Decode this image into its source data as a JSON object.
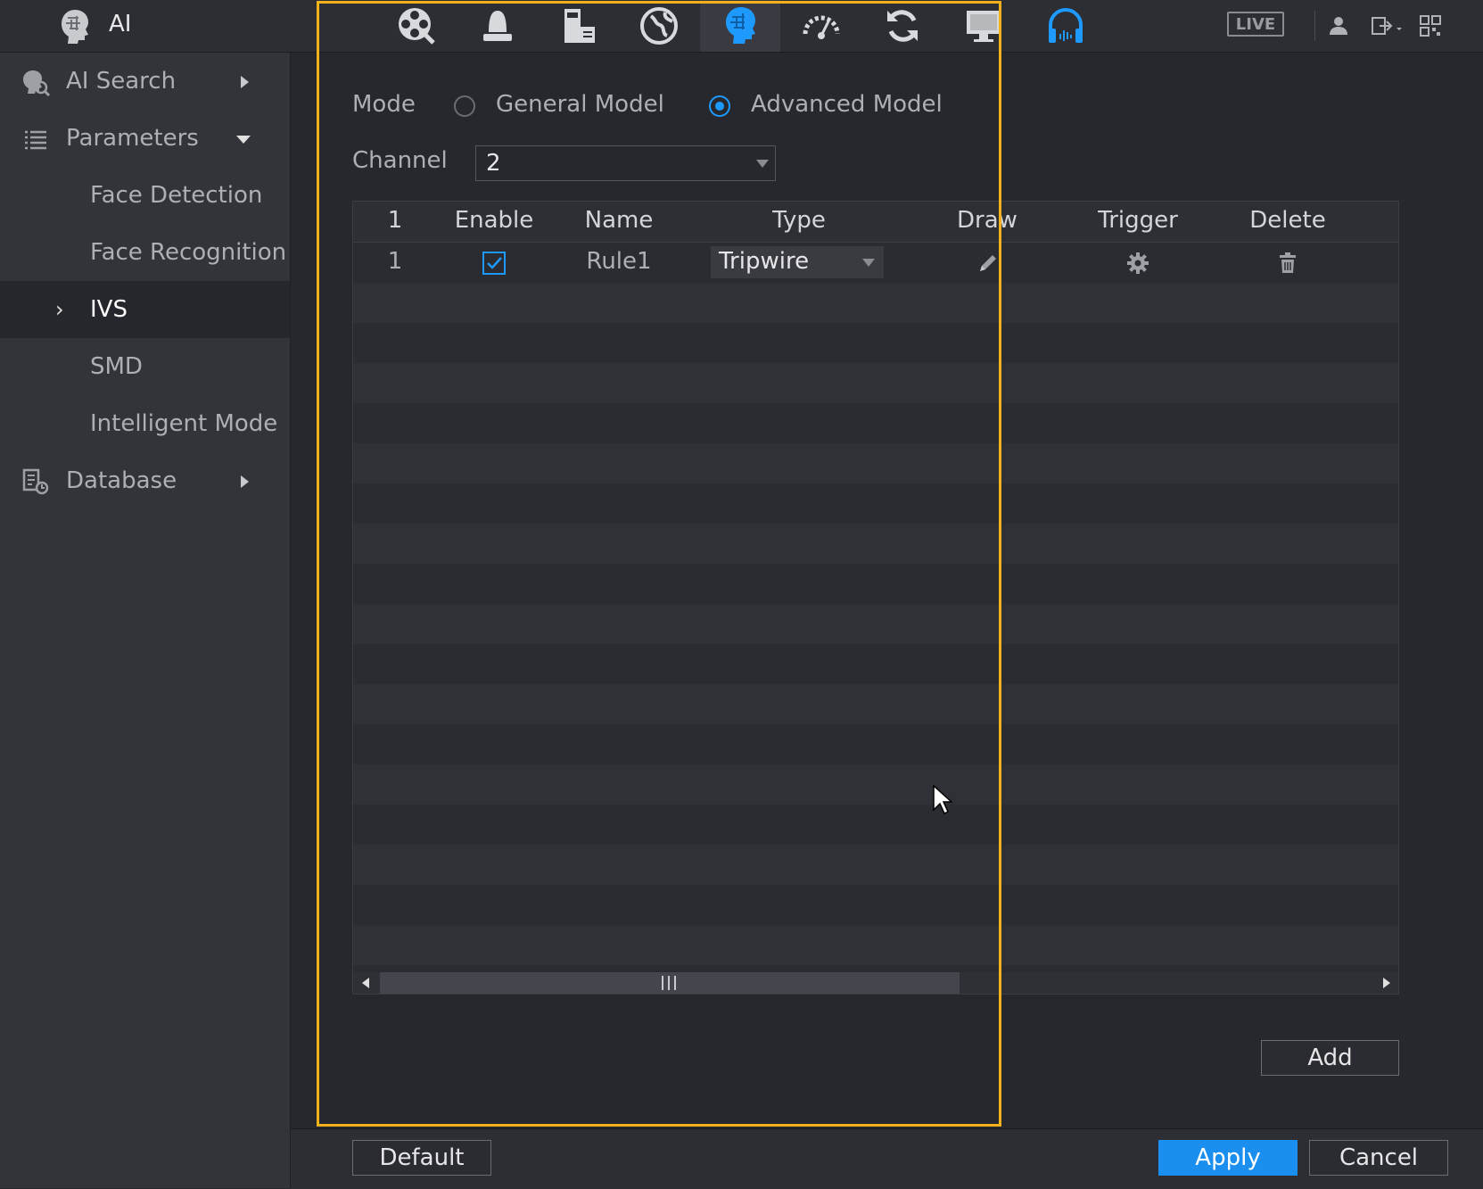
{
  "app": {
    "title": "AI"
  },
  "topbar": {
    "icons": [
      "playback-icon",
      "alarm-icon",
      "operation-icon",
      "network-icon",
      "ai-icon",
      "performance-icon",
      "maintenance-icon",
      "display-icon",
      "audio-icon"
    ],
    "active_icon": "ai-icon",
    "live_label": "LIVE",
    "right_icons": [
      "user-icon",
      "logout-icon",
      "qr-code-icon"
    ]
  },
  "sidebar": {
    "items": [
      {
        "label": "AI Search"
      },
      {
        "label": "Parameters"
      },
      {
        "label": "Face Detection"
      },
      {
        "label": "Face Recognition"
      },
      {
        "label": "IVS"
      },
      {
        "label": "SMD"
      },
      {
        "label": "Intelligent Mode"
      },
      {
        "label": "Database"
      }
    ],
    "selected": "IVS"
  },
  "form": {
    "mode_label": "Mode",
    "mode_options": [
      "General Model",
      "Advanced Model"
    ],
    "mode_selected": "Advanced Model",
    "channel_label": "Channel",
    "channel_value": "2"
  },
  "table": {
    "headers": [
      "1",
      "Enable",
      "Name",
      "Type",
      "Draw",
      "Trigger",
      "Delete"
    ],
    "rows": [
      {
        "index": "1",
        "enabled": true,
        "name": "Rule1",
        "type": "Tripwire"
      }
    ]
  },
  "buttons": {
    "add": "Add",
    "default": "Default",
    "apply": "Apply",
    "cancel": "Cancel"
  },
  "colors": {
    "accent": "#1e9aff",
    "highlight_border": "#f3b21b"
  }
}
